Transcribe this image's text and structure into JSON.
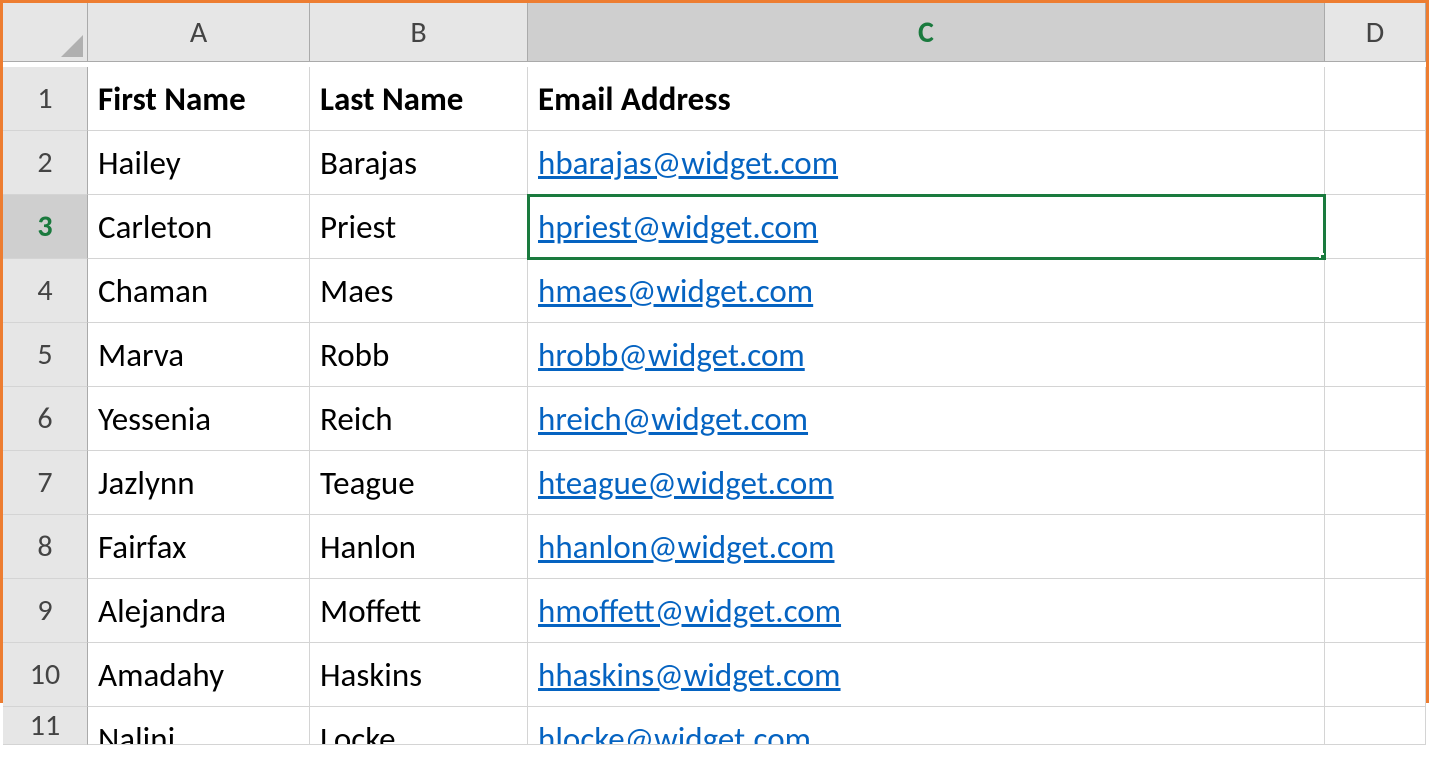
{
  "columns": [
    "A",
    "B",
    "C",
    "D"
  ],
  "selectedCell": {
    "col": "C",
    "row": 3
  },
  "headerRow": 1,
  "headers": {
    "A": "First Name",
    "B": "Last Name",
    "C": "Email Address"
  },
  "rows": [
    {
      "num": 2,
      "A": "Hailey",
      "B": "Barajas",
      "C": "hbarajas@widget.com"
    },
    {
      "num": 3,
      "A": "Carleton",
      "B": "Priest",
      "C": "hpriest@widget.com"
    },
    {
      "num": 4,
      "A": "Chaman",
      "B": "Maes",
      "C": "hmaes@widget.com"
    },
    {
      "num": 5,
      "A": "Marva",
      "B": "Robb",
      "C": "hrobb@widget.com"
    },
    {
      "num": 6,
      "A": "Yessenia",
      "B": "Reich",
      "C": "hreich@widget.com"
    },
    {
      "num": 7,
      "A": "Jazlynn",
      "B": "Teague",
      "C": "hteague@widget.com"
    },
    {
      "num": 8,
      "A": "Fairfax",
      "B": "Hanlon",
      "C": "hhanlon@widget.com"
    },
    {
      "num": 9,
      "A": "Alejandra",
      "B": "Moffett",
      "C": "hmoffett@widget.com"
    },
    {
      "num": 10,
      "A": "Amadahy",
      "B": "Haskins",
      "C": "hhaskins@widget.com"
    },
    {
      "num": 11,
      "A": "Nalini",
      "B": "Locke",
      "C": "hlocke@widget.com"
    }
  ],
  "colors": {
    "accent": "#1a7a3e",
    "link": "#0563c1",
    "border": "#ed7d31"
  }
}
